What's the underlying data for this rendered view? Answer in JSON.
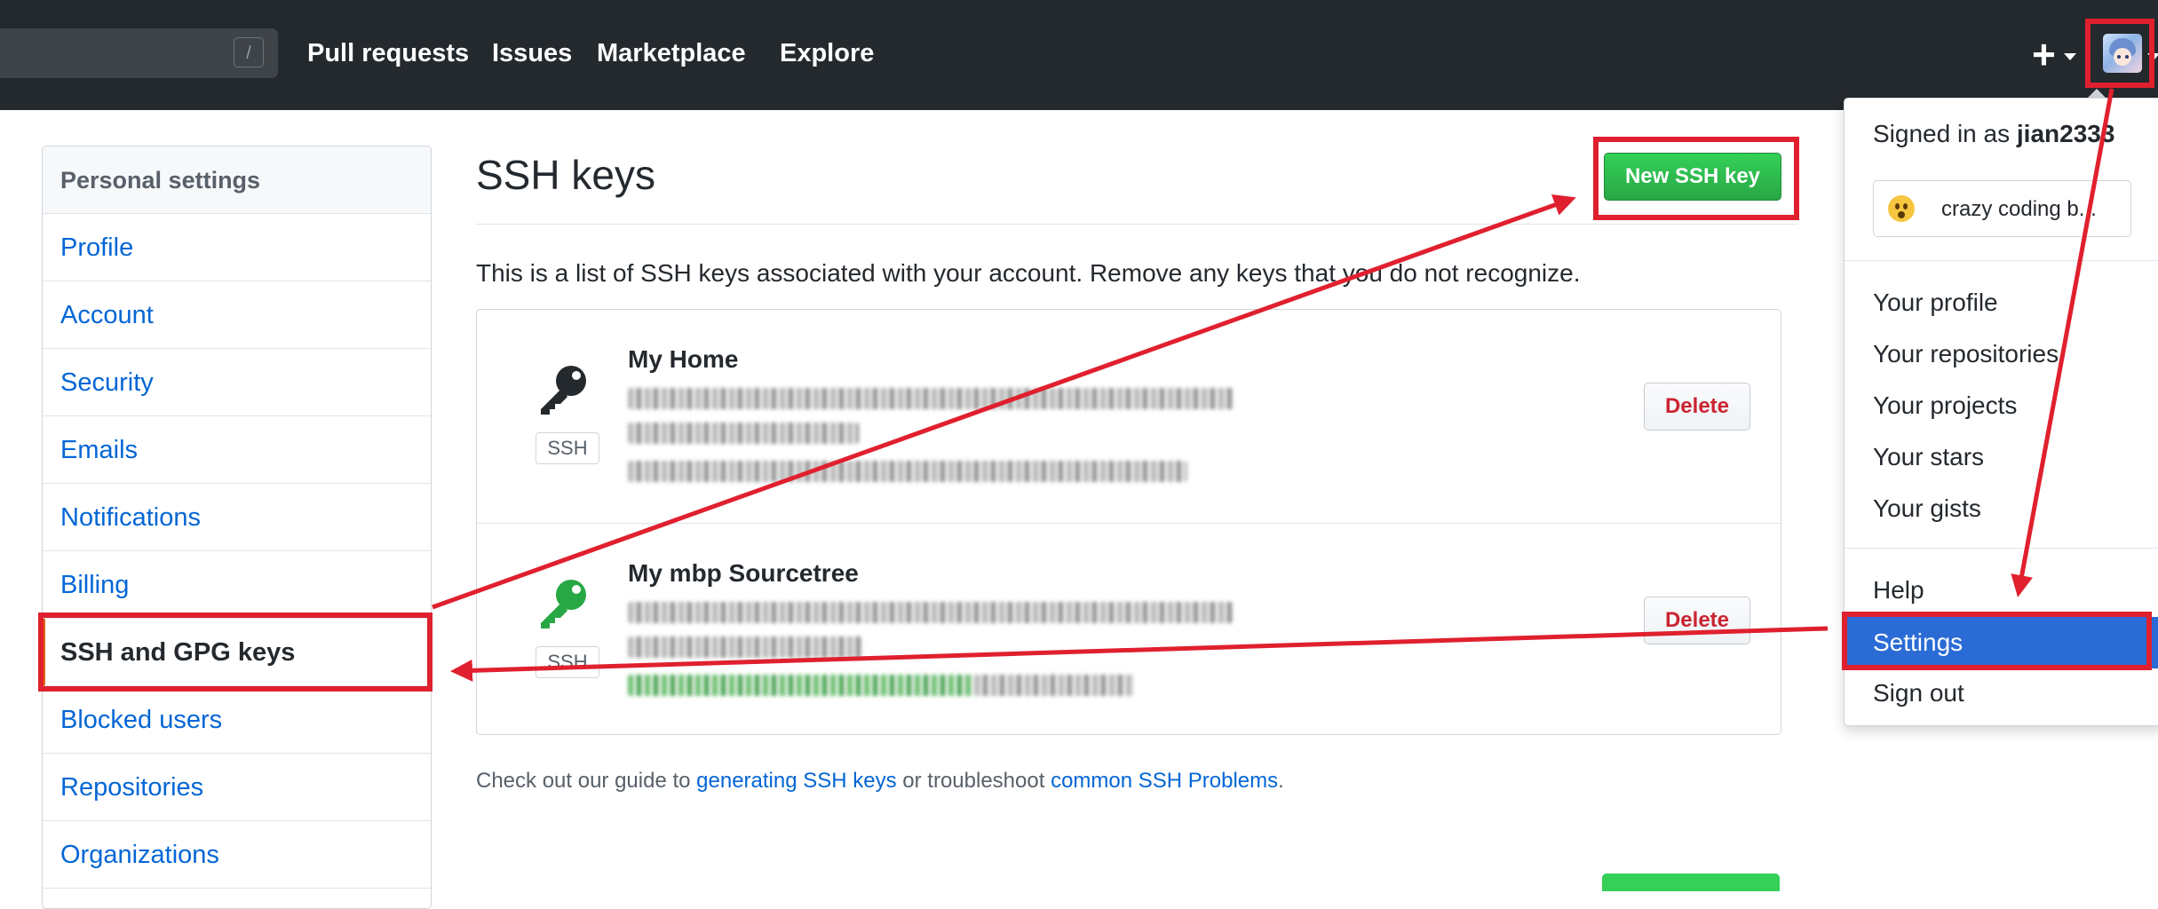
{
  "header": {
    "search_shortcut": "/",
    "nav": [
      "Pull requests",
      "Issues",
      "Marketplace",
      "Explore"
    ],
    "new_icon": "plus-icon",
    "avatar_icon": "user-avatar"
  },
  "sidebar": {
    "heading": "Personal settings",
    "items": [
      {
        "label": "Profile"
      },
      {
        "label": "Account"
      },
      {
        "label": "Security"
      },
      {
        "label": "Emails"
      },
      {
        "label": "Notifications"
      },
      {
        "label": "Billing"
      },
      {
        "label": "SSH and GPG keys",
        "selected": true
      },
      {
        "label": "Blocked users"
      },
      {
        "label": "Repositories"
      },
      {
        "label": "Organizations"
      }
    ]
  },
  "main": {
    "title": "SSH keys",
    "new_key_button": "New SSH key",
    "description": "This is a list of SSH keys associated with your account. Remove any keys that you do not recognize.",
    "keys": [
      {
        "name": "My Home",
        "badge": "SSH",
        "delete_label": "Delete",
        "icon": "key-icon",
        "icon_color": "#24292e"
      },
      {
        "name": "My mbp Sourcetree",
        "badge": "SSH",
        "delete_label": "Delete",
        "icon": "key-icon",
        "icon_color": "#28a745"
      }
    ],
    "footer": {
      "prefix": "Check out our guide to ",
      "link1": "generating SSH keys",
      "middle": " or troubleshoot ",
      "link2": "common SSH Problems",
      "suffix": "."
    }
  },
  "dropdown": {
    "signed_in_prefix": "Signed in as ",
    "username": "jian2333",
    "status_emoji": "astonished-face-emoji",
    "status_text": "crazy coding b...",
    "items": [
      "Your profile",
      "Your repositories",
      "Your projects",
      "Your stars",
      "Your gists"
    ],
    "help": "Help",
    "settings": "Settings",
    "sign_out": "Sign out"
  },
  "colors": {
    "header_bg": "#24292e",
    "link": "#0366d6",
    "primary_button": "#28a745",
    "danger": "#cb2431",
    "annotation_red": "#e0202e",
    "menu_highlight": "#2b6bd6"
  }
}
